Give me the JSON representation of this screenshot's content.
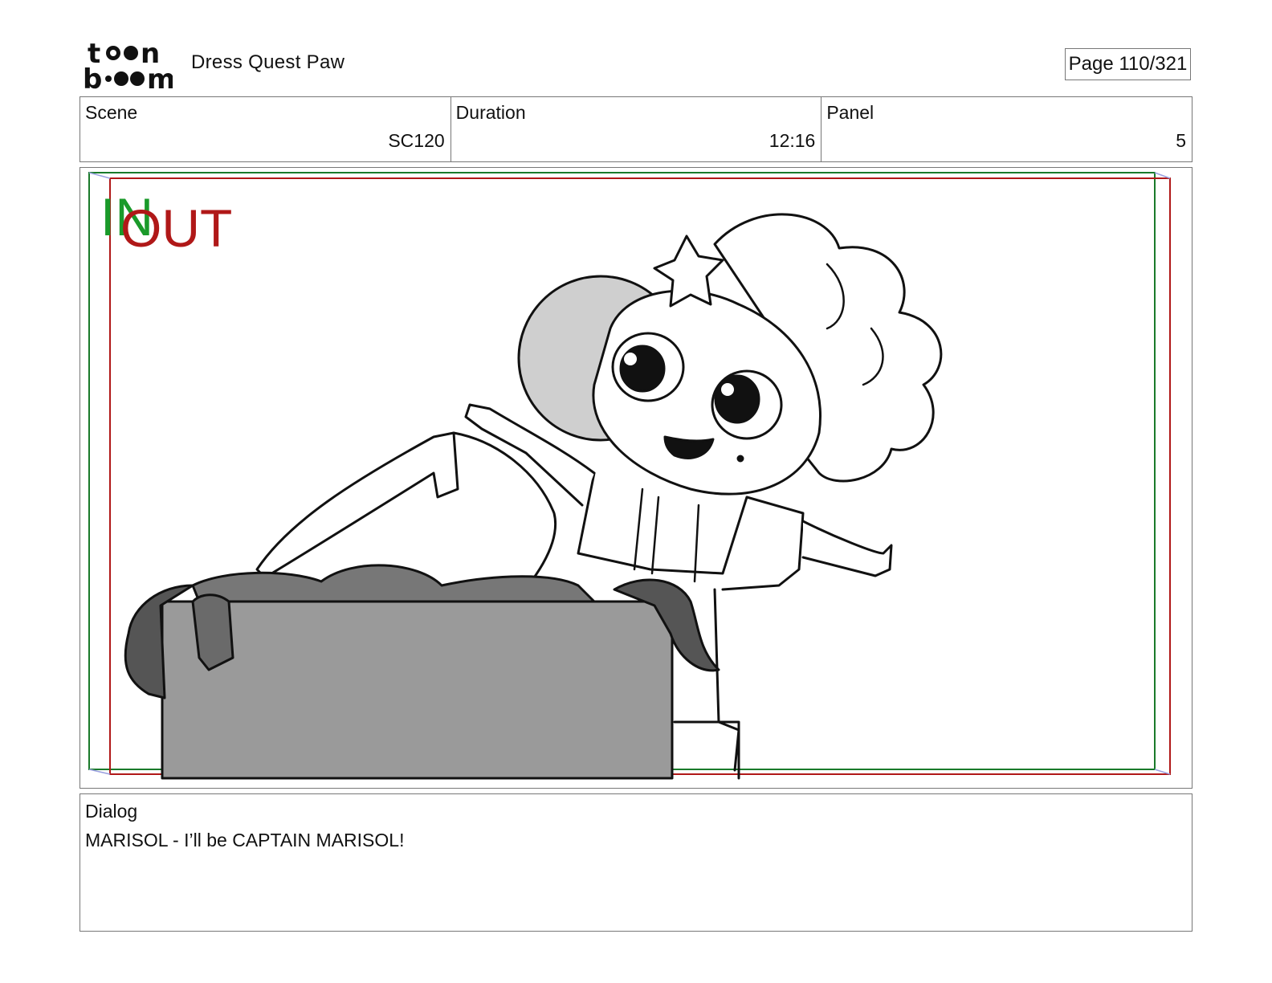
{
  "header": {
    "logo_text": "toon boom",
    "project_title": "Dress Quest Paw",
    "page_indicator": "Page 110/321"
  },
  "info": {
    "scene_label": "Scene",
    "scene_value": "SC120",
    "duration_label": "Duration",
    "duration_value": "12:16",
    "panel_label": "Panel",
    "panel_value": "5"
  },
  "panel": {
    "in_marker": "IN",
    "out_marker": "OUT",
    "in_color": "#1a9a2a",
    "out_color": "#b01818"
  },
  "dialog": {
    "label": "Dialog",
    "text": "MARISOL - I’ll be CAPTAIN MARISOL!"
  }
}
